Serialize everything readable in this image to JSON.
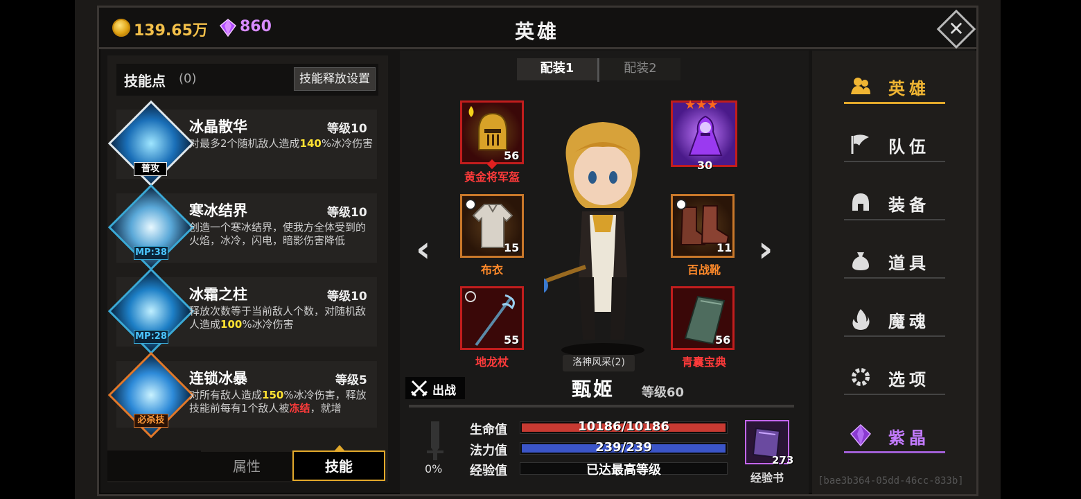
{
  "header": {
    "gold": "139.65万",
    "gems": "860",
    "title": "英雄"
  },
  "skills": {
    "points_label": "技能点",
    "points_count": "(0)",
    "release_settings": "技能释放设置",
    "items": [
      {
        "name": "冰晶散华",
        "level": "等级10",
        "desc_pre": "对最多2个随机敌人造成",
        "desc_hl": "140",
        "desc_post": "%冰冷伤害",
        "tag": "普攻"
      },
      {
        "name": "寒冰结界",
        "level": "等级10",
        "desc_pre": "创造一个寒冰结界，使我方全体受到的火焰，冰冷，闪电，暗影伤害降低",
        "desc_hl": "",
        "desc_post": "",
        "tag": "MP:38"
      },
      {
        "name": "冰霜之柱",
        "level": "等级10",
        "desc_pre": "释放次数等于当前敌人个数，对随机敌人造成",
        "desc_hl": "100",
        "desc_post": "%冰冷伤害",
        "tag": "MP:28"
      },
      {
        "name": "连锁冰暴",
        "level": "等级5",
        "desc_pre": "对所有敌人造成",
        "desc_hl": "150",
        "desc_mid": "%冰冷伤害，释放技能前每有1个敌人被",
        "desc_hl2": "冻结",
        "desc_post": "，就增",
        "tag": "必杀技"
      }
    ],
    "tabs": {
      "attr": "属性",
      "skill": "技能"
    }
  },
  "loadout": {
    "tab1": "配装1",
    "tab2": "配装2"
  },
  "equipment": {
    "helmet": {
      "name": "黄金将军盔",
      "count": "56"
    },
    "pet": {
      "count": "30"
    },
    "armor": {
      "name": "布衣",
      "count": "15"
    },
    "boots": {
      "name": "百战靴",
      "count": "11"
    },
    "weapon": {
      "name": "地龙杖",
      "count": "55"
    },
    "book": {
      "name": "青囊宝典",
      "count": "56"
    }
  },
  "hero": {
    "set_bonus": "洛神风采(2)",
    "deploy": "出战",
    "name": "甄姬",
    "level": "等级60",
    "power_pct": "0%",
    "hp_label": "生命值",
    "hp_value": "10186/10186",
    "hp_fraction": 1.0,
    "mp_label": "法力值",
    "mp_value": "239/239",
    "mp_fraction": 1.0,
    "exp_label": "经验值",
    "exp_value": "已达最高等级",
    "expbook_count": "273",
    "expbook_label": "经验书"
  },
  "nav": {
    "items": [
      {
        "label": "英雄",
        "icon": "hero-icon"
      },
      {
        "label": "队伍",
        "icon": "flag-icon"
      },
      {
        "label": "装备",
        "icon": "helmet-icon"
      },
      {
        "label": "道具",
        "icon": "bag-icon"
      },
      {
        "label": "魔魂",
        "icon": "flame-icon"
      },
      {
        "label": "选项",
        "icon": "gear-icon"
      },
      {
        "label": "紫晶",
        "icon": "crystal-icon"
      }
    ]
  },
  "footer_id": "[bae3b364-05dd-46cc-833b]",
  "colors": {
    "accent": "#e3a92b",
    "gold": "#f3c04a",
    "gem": "#d88cff",
    "hp": "#c83a32",
    "mp": "#3b55c8"
  }
}
